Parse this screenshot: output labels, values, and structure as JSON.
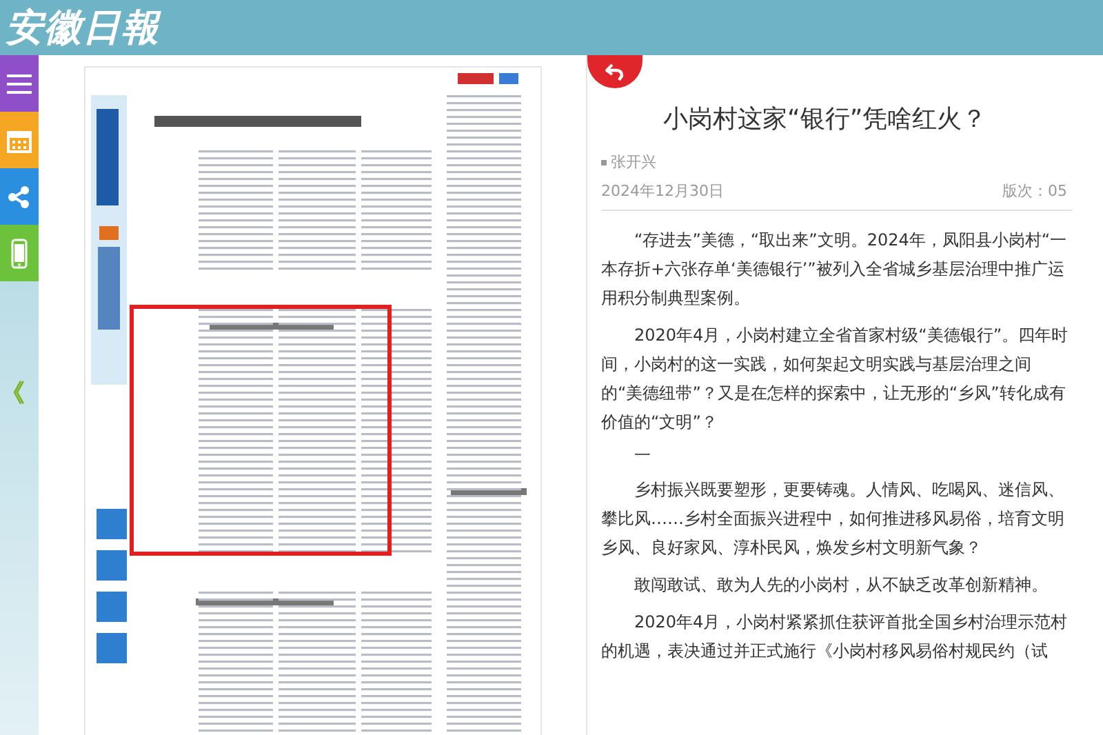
{
  "header": {
    "logo": "安徽日報"
  },
  "sidebar": {
    "items": [
      {
        "kind": "menu",
        "color": "#8e4fc9"
      },
      {
        "kind": "calendar",
        "color": "#f5a623"
      },
      {
        "kind": "share",
        "color": "#2b8fe0"
      },
      {
        "kind": "mobile",
        "color": "#6cc23a"
      }
    ],
    "collapse": "《"
  },
  "article": {
    "title": "小岗村这家“银行”凭啥红火？",
    "author": "张开兴",
    "date": "2024年12月30日",
    "edition": "版次：05",
    "paragraphs": [
      {
        "kind": "text",
        "text": "“存进去”美德，“取出来”文明。2024年，凤阳县小岗村“一本存折+六张存单‘美德银行’”被列入全省城乡基层治理中推广运用积分制典型案例。"
      },
      {
        "kind": "text",
        "text": "2020年4月，小岗村建立全省首家村级“美德银行”。四年时间，小岗村的这一实践，如何架起文明实践与基层治理之间的“美德纽带”？又是在怎样的探索中，让无形的“乡风”转化成有价值的“文明”？"
      },
      {
        "kind": "section",
        "text": "一"
      },
      {
        "kind": "text",
        "text": "乡村振兴既要塑形，更要铸魂。人情风、吃喝风、迷信风、攀比风……乡村全面振兴进程中，如何推进移风易俗，培育文明乡风、良好家风、淳朴民风，焕发乡村文明新气象？"
      },
      {
        "kind": "text",
        "text": "敢闯敢试、敢为人先的小岗村，从不缺乏改革创新精神。"
      },
      {
        "kind": "text",
        "text": "2020年4月，小岗村紧紧抓住获评首批全国乡村治理示范村的机遇，表决通过并正式施行《小岗村移风易俗村规民约（试"
      }
    ]
  }
}
